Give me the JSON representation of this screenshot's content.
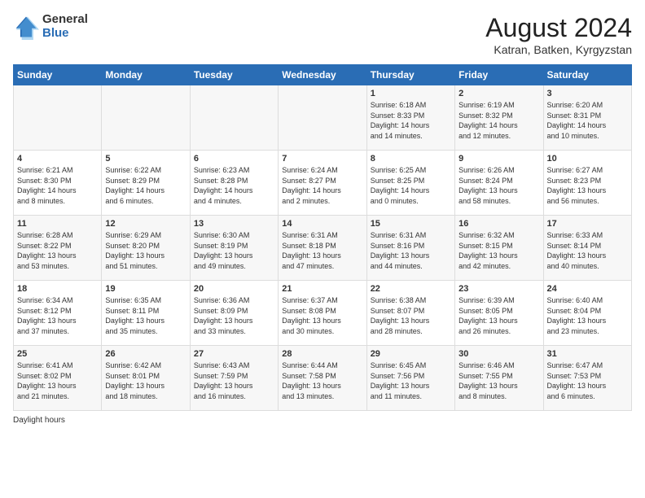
{
  "header": {
    "logo_general": "General",
    "logo_blue": "Blue",
    "month_year": "August 2024",
    "location": "Katran, Batken, Kyrgyzstan"
  },
  "days_of_week": [
    "Sunday",
    "Monday",
    "Tuesday",
    "Wednesday",
    "Thursday",
    "Friday",
    "Saturday"
  ],
  "weeks": [
    [
      {
        "day": "",
        "info": ""
      },
      {
        "day": "",
        "info": ""
      },
      {
        "day": "",
        "info": ""
      },
      {
        "day": "",
        "info": ""
      },
      {
        "day": "1",
        "info": "Sunrise: 6:18 AM\nSunset: 8:33 PM\nDaylight: 14 hours\nand 14 minutes."
      },
      {
        "day": "2",
        "info": "Sunrise: 6:19 AM\nSunset: 8:32 PM\nDaylight: 14 hours\nand 12 minutes."
      },
      {
        "day": "3",
        "info": "Sunrise: 6:20 AM\nSunset: 8:31 PM\nDaylight: 14 hours\nand 10 minutes."
      }
    ],
    [
      {
        "day": "4",
        "info": "Sunrise: 6:21 AM\nSunset: 8:30 PM\nDaylight: 14 hours\nand 8 minutes."
      },
      {
        "day": "5",
        "info": "Sunrise: 6:22 AM\nSunset: 8:29 PM\nDaylight: 14 hours\nand 6 minutes."
      },
      {
        "day": "6",
        "info": "Sunrise: 6:23 AM\nSunset: 8:28 PM\nDaylight: 14 hours\nand 4 minutes."
      },
      {
        "day": "7",
        "info": "Sunrise: 6:24 AM\nSunset: 8:27 PM\nDaylight: 14 hours\nand 2 minutes."
      },
      {
        "day": "8",
        "info": "Sunrise: 6:25 AM\nSunset: 8:25 PM\nDaylight: 14 hours\nand 0 minutes."
      },
      {
        "day": "9",
        "info": "Sunrise: 6:26 AM\nSunset: 8:24 PM\nDaylight: 13 hours\nand 58 minutes."
      },
      {
        "day": "10",
        "info": "Sunrise: 6:27 AM\nSunset: 8:23 PM\nDaylight: 13 hours\nand 56 minutes."
      }
    ],
    [
      {
        "day": "11",
        "info": "Sunrise: 6:28 AM\nSunset: 8:22 PM\nDaylight: 13 hours\nand 53 minutes."
      },
      {
        "day": "12",
        "info": "Sunrise: 6:29 AM\nSunset: 8:20 PM\nDaylight: 13 hours\nand 51 minutes."
      },
      {
        "day": "13",
        "info": "Sunrise: 6:30 AM\nSunset: 8:19 PM\nDaylight: 13 hours\nand 49 minutes."
      },
      {
        "day": "14",
        "info": "Sunrise: 6:31 AM\nSunset: 8:18 PM\nDaylight: 13 hours\nand 47 minutes."
      },
      {
        "day": "15",
        "info": "Sunrise: 6:31 AM\nSunset: 8:16 PM\nDaylight: 13 hours\nand 44 minutes."
      },
      {
        "day": "16",
        "info": "Sunrise: 6:32 AM\nSunset: 8:15 PM\nDaylight: 13 hours\nand 42 minutes."
      },
      {
        "day": "17",
        "info": "Sunrise: 6:33 AM\nSunset: 8:14 PM\nDaylight: 13 hours\nand 40 minutes."
      }
    ],
    [
      {
        "day": "18",
        "info": "Sunrise: 6:34 AM\nSunset: 8:12 PM\nDaylight: 13 hours\nand 37 minutes."
      },
      {
        "day": "19",
        "info": "Sunrise: 6:35 AM\nSunset: 8:11 PM\nDaylight: 13 hours\nand 35 minutes."
      },
      {
        "day": "20",
        "info": "Sunrise: 6:36 AM\nSunset: 8:09 PM\nDaylight: 13 hours\nand 33 minutes."
      },
      {
        "day": "21",
        "info": "Sunrise: 6:37 AM\nSunset: 8:08 PM\nDaylight: 13 hours\nand 30 minutes."
      },
      {
        "day": "22",
        "info": "Sunrise: 6:38 AM\nSunset: 8:07 PM\nDaylight: 13 hours\nand 28 minutes."
      },
      {
        "day": "23",
        "info": "Sunrise: 6:39 AM\nSunset: 8:05 PM\nDaylight: 13 hours\nand 26 minutes."
      },
      {
        "day": "24",
        "info": "Sunrise: 6:40 AM\nSunset: 8:04 PM\nDaylight: 13 hours\nand 23 minutes."
      }
    ],
    [
      {
        "day": "25",
        "info": "Sunrise: 6:41 AM\nSunset: 8:02 PM\nDaylight: 13 hours\nand 21 minutes."
      },
      {
        "day": "26",
        "info": "Sunrise: 6:42 AM\nSunset: 8:01 PM\nDaylight: 13 hours\nand 18 minutes."
      },
      {
        "day": "27",
        "info": "Sunrise: 6:43 AM\nSunset: 7:59 PM\nDaylight: 13 hours\nand 16 minutes."
      },
      {
        "day": "28",
        "info": "Sunrise: 6:44 AM\nSunset: 7:58 PM\nDaylight: 13 hours\nand 13 minutes."
      },
      {
        "day": "29",
        "info": "Sunrise: 6:45 AM\nSunset: 7:56 PM\nDaylight: 13 hours\nand 11 minutes."
      },
      {
        "day": "30",
        "info": "Sunrise: 6:46 AM\nSunset: 7:55 PM\nDaylight: 13 hours\nand 8 minutes."
      },
      {
        "day": "31",
        "info": "Sunrise: 6:47 AM\nSunset: 7:53 PM\nDaylight: 13 hours\nand 6 minutes."
      }
    ]
  ],
  "footer": {
    "daylight_hours": "Daylight hours"
  }
}
